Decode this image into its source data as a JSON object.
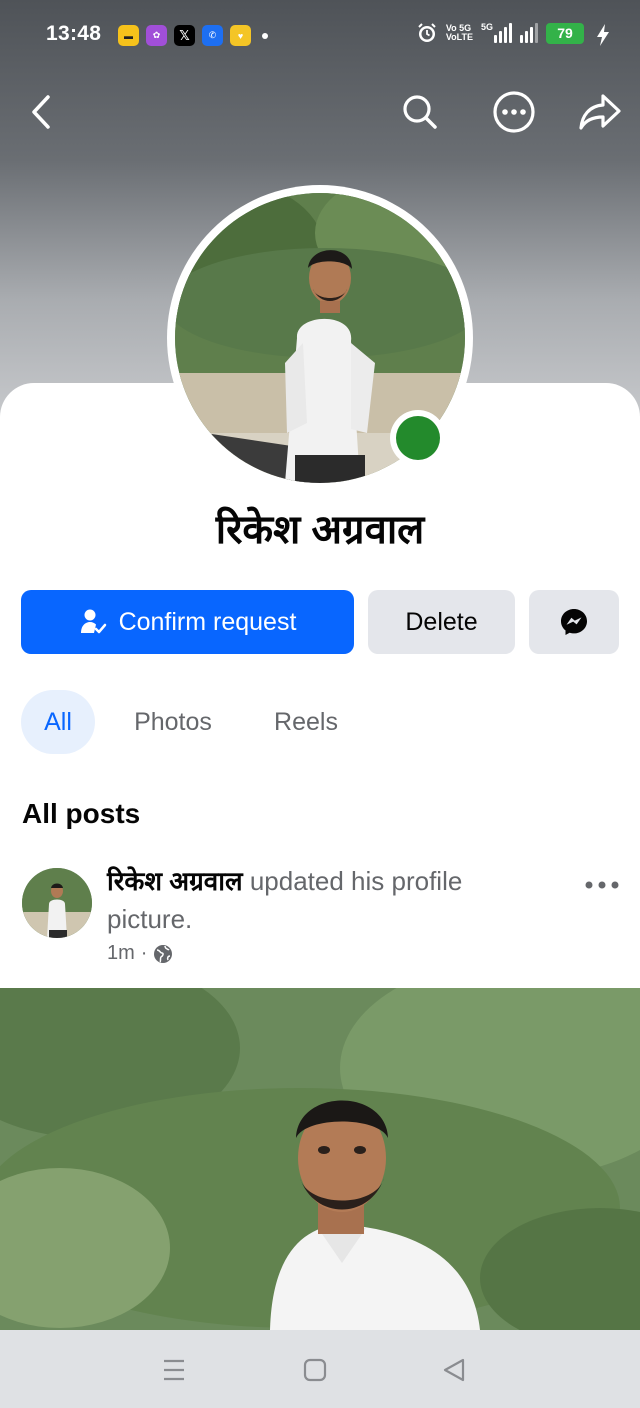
{
  "status_bar": {
    "time": "13:48",
    "notification_icons": [
      "rapido-icon",
      "lotus-app-icon",
      "x-icon",
      "truecaller-icon",
      "heart-app-icon"
    ],
    "network_label_top": "Vo 5G",
    "network_label_bottom": "VoLTE",
    "network_5g": "5G",
    "battery_level": "79"
  },
  "profile": {
    "name": "रिकेश अग्रवाल",
    "online": true
  },
  "actions": {
    "confirm_label": "Confirm request",
    "delete_label": "Delete"
  },
  "tabs": [
    {
      "label": "All",
      "active": true
    },
    {
      "label": "Photos",
      "active": false
    },
    {
      "label": "Reels",
      "active": false
    }
  ],
  "section_title": "All posts",
  "post": {
    "author": "रिकेश अग्रवाल",
    "action_text": "updated his profile picture.",
    "time": "1m",
    "separator": "·",
    "privacy_icon": "globe-icon"
  },
  "colors": {
    "brand_blue": "#0866ff",
    "online_green": "#238a2c",
    "secondary_button": "#e4e6eb",
    "active_tab_bg": "#e7f0fd"
  }
}
